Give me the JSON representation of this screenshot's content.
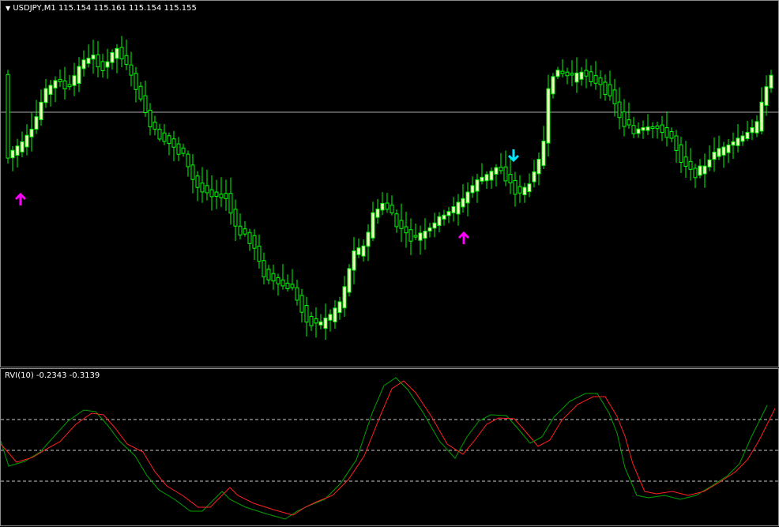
{
  "main": {
    "symbol_label": "USDJPY,M1",
    "ohlc_label": "115.154 115.161 115.154 115.155",
    "colors": {
      "background": "#000000",
      "candle": "#00ff00",
      "bull_body": "#ffffcc",
      "hline": "#aaaaaa",
      "arrow_up": "#ff00ff",
      "arrow_down": "#00e5ff"
    },
    "icons": [
      "triangle-down-icon",
      "arrow-up-icon",
      "arrow-down-icon"
    ]
  },
  "rvi": {
    "title": "RVI(10) -0.2343 -0.3139",
    "colors": {
      "main": "#00a000",
      "signal": "#ff2020",
      "levels": "#c8c8c8"
    }
  }
}
